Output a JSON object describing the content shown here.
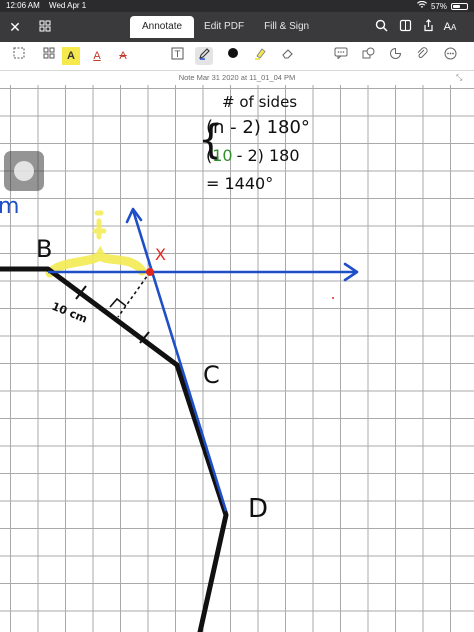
{
  "status_bar": {
    "time": "12:06 AM",
    "date": "Wed Apr 1",
    "battery_percent_text": "57%",
    "battery_level": 0.57
  },
  "topbar": {
    "tabs": [
      {
        "label": "Annotate",
        "active": true
      },
      {
        "label": "Edit PDF",
        "active": false
      },
      {
        "label": "Fill & Sign",
        "active": false
      }
    ],
    "icons": [
      "close-icon",
      "grid-icon",
      "search-icon",
      "bookmark-icon",
      "share-icon",
      "text-size-icon"
    ]
  },
  "toolbar": {
    "tools": [
      "select-tool",
      "highlight-tool",
      "underline-tool",
      "strikethrough-tool",
      "textbox-tool",
      "pen-tool",
      "color-dot",
      "highlighter-tool",
      "eraser-tool",
      "comment-tool",
      "shapes-tool",
      "stamp-tool",
      "attach-tool",
      "more-tool"
    ]
  },
  "note": {
    "title": "Note Mar 31 2020 at 11_01_04 PM"
  },
  "handwriting": {
    "heading": "# of sides",
    "formula_line1": "(n - 2) 180°",
    "formula_line2_num": "10",
    "formula_line2_rest": "- 2) 180",
    "result": "= 1440°",
    "label_b": "B",
    "label_x": "X",
    "label_c": "C",
    "label_d": "D",
    "side_length": "10 cm",
    "left_scribble": "m"
  },
  "colors": {
    "ink_black": "#111111",
    "ink_blue": "#1f4fc8",
    "ink_red": "#e0281f",
    "ink_green": "#2f8f2a",
    "highlight_yellow": "#f3ea52"
  }
}
